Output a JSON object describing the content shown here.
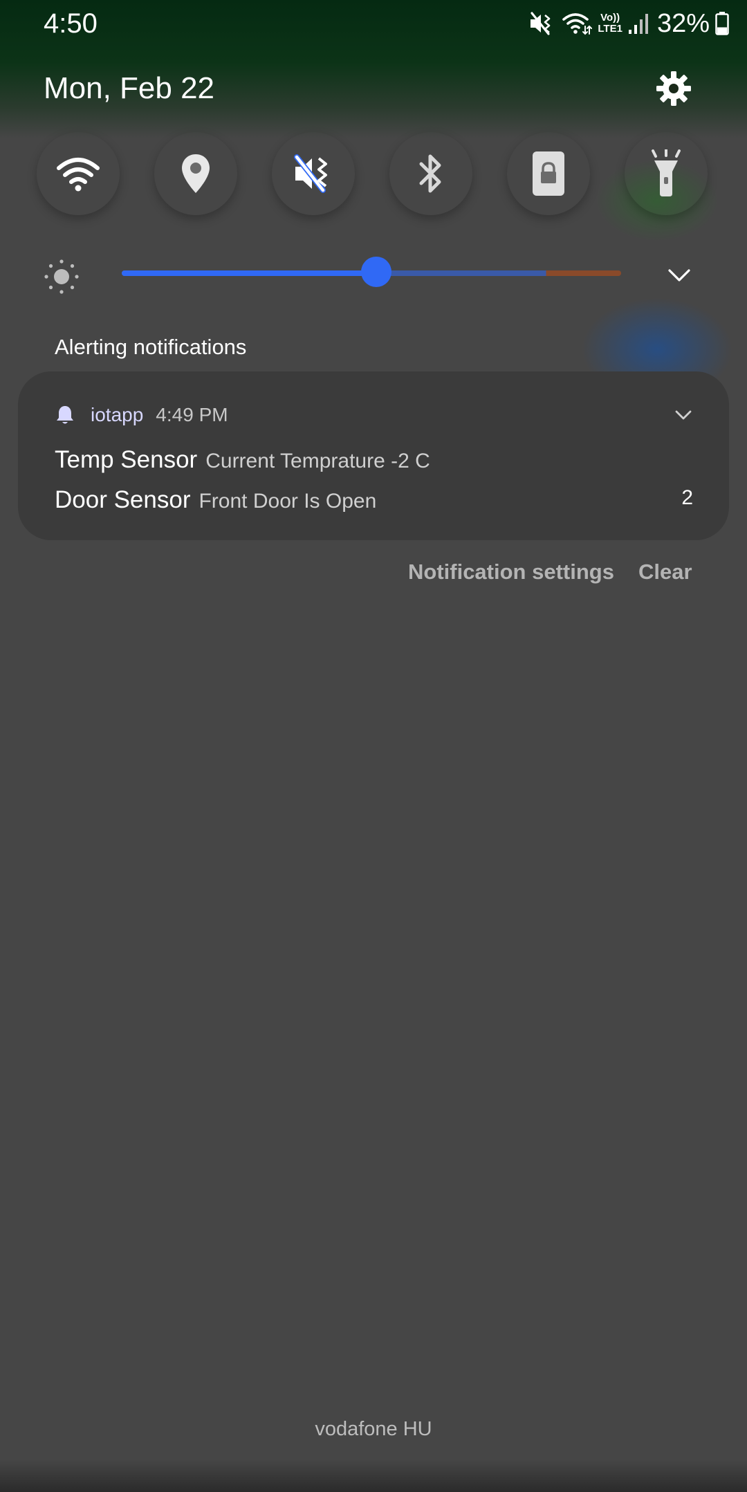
{
  "status_bar": {
    "time": "4:50",
    "volte_top": "Vo))",
    "volte_bottom": "LTE1",
    "battery_percent": "32%",
    "battery_level": 0.32,
    "icons": [
      "mute-vibrate-icon",
      "wifi-icon",
      "volte-icon",
      "signal-icon",
      "battery-icon"
    ]
  },
  "header": {
    "date": "Mon, Feb 22",
    "settings_icon": "gear-icon"
  },
  "quick_toggles": [
    {
      "name": "wifi",
      "icon": "wifi-icon",
      "state": "on"
    },
    {
      "name": "location",
      "icon": "location-pin-icon",
      "state": "off"
    },
    {
      "name": "sound",
      "icon": "mute-vibrate-icon",
      "state": "on"
    },
    {
      "name": "bluetooth",
      "icon": "bluetooth-icon",
      "state": "off"
    },
    {
      "name": "screen-lock",
      "icon": "screen-lock-icon",
      "state": "off"
    },
    {
      "name": "flashlight",
      "icon": "flashlight-icon",
      "state": "off"
    }
  ],
  "brightness": {
    "level": 0.51,
    "icon": "sun-icon",
    "expand_icon": "chevron-down-icon"
  },
  "notifications": {
    "section_label": "Alerting notifications",
    "app_name": "iotapp",
    "time": "4:49 PM",
    "items": [
      {
        "title": "Temp Sensor",
        "body": "Current Temprature -2 C"
      },
      {
        "title": "Door Sensor",
        "body": "Front Door Is Open"
      }
    ],
    "count": "2"
  },
  "actions": {
    "settings_label": "Notification settings",
    "clear_label": "Clear"
  },
  "carrier": "vodafone HU",
  "colors": {
    "accent": "#3069f5",
    "background": "#464646",
    "card": "#3b3b3b",
    "toggle_off": "#6b6b6b"
  }
}
